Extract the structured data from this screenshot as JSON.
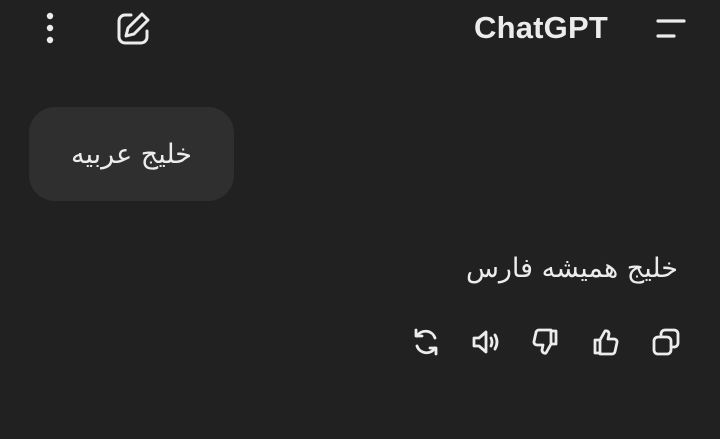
{
  "header": {
    "title": "ChatGPT",
    "icons": {
      "left": [
        "more-vertical-icon",
        "edit-icon"
      ],
      "right": [
        "menu-icon"
      ]
    }
  },
  "conversation": {
    "user_message": "خلیج عربیه",
    "assistant_message": "خلیج همیشه فارس",
    "actions": [
      "copy-icon",
      "thumbs-up-icon",
      "thumbs-down-icon",
      "speaker-icon",
      "regenerate-icon"
    ]
  },
  "colors": {
    "background": "#212121",
    "bubble": "#2f2f2f",
    "text": "#ececec"
  }
}
